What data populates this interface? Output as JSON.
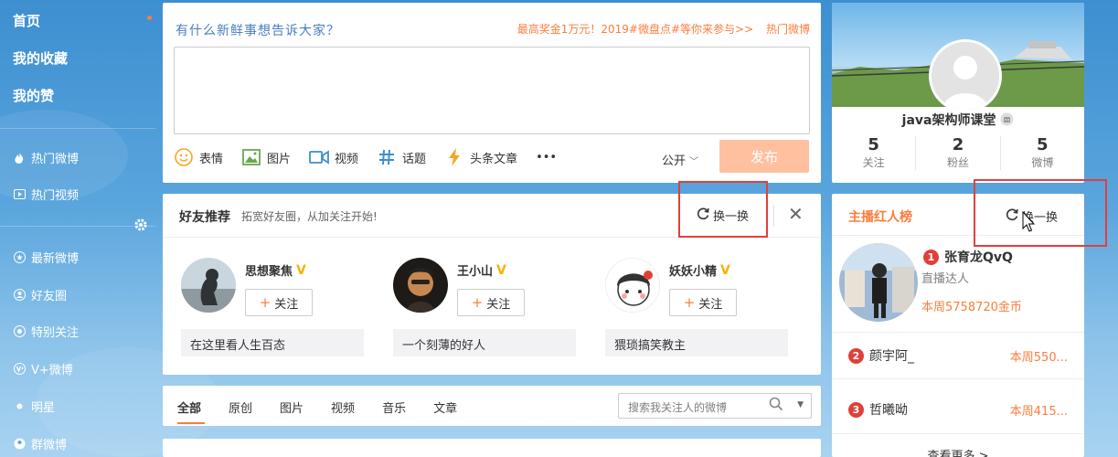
{
  "sidebar": {
    "items": [
      {
        "label": "首页",
        "icon": "home"
      },
      {
        "label": "我的收藏",
        "icon": "favorites"
      },
      {
        "label": "我的赞",
        "icon": "likes"
      },
      {
        "label": "热门微博",
        "icon": "fire-icon"
      },
      {
        "label": "热门视频",
        "icon": "video-icon"
      },
      {
        "label": "最新微博",
        "icon": "star-icon"
      },
      {
        "label": "好友圈",
        "icon": "friends-icon"
      },
      {
        "label": "特别关注",
        "icon": "target-icon"
      },
      {
        "label": "V+微博",
        "icon": "v-plus-icon"
      },
      {
        "label": "明星",
        "icon": "dot-icon"
      },
      {
        "label": "群微博",
        "icon": "group-icon"
      }
    ]
  },
  "composer": {
    "hint": "有什么新鲜事想告诉大家？",
    "promo": "最高奖金1万元！2019#微盘点#等你来参与>>",
    "hot_link": "热门微博",
    "tools": [
      {
        "label": "表情",
        "icon": "emoji-icon"
      },
      {
        "label": "图片",
        "icon": "image-icon"
      },
      {
        "label": "视频",
        "icon": "video-camera-icon"
      },
      {
        "label": "话题",
        "icon": "hashtag-icon"
      },
      {
        "label": "头条文章",
        "icon": "lightning-icon"
      },
      {
        "label": "•••",
        "icon": "more-icon"
      }
    ],
    "visibility": "公开",
    "publish": "发布"
  },
  "friends": {
    "title": "好友推荐",
    "subtitle": "拓宽好友圈，从加关注开始!",
    "refresh": "换一换",
    "follow_label": "关注",
    "list": [
      {
        "name": "思想聚焦",
        "desc": "在这里看人生百态"
      },
      {
        "name": "王小山",
        "desc": "一个刻薄的好人"
      },
      {
        "name": "妖妖小精",
        "desc": "猥琐搞笑教主"
      }
    ]
  },
  "feed": {
    "tabs": [
      "全部",
      "原创",
      "图片",
      "视频",
      "音乐",
      "文章"
    ],
    "search_placeholder": "搜索我关注人的微博"
  },
  "profile": {
    "name": "java架构师课堂",
    "stats": [
      {
        "num": "5",
        "label": "关注"
      },
      {
        "num": "2",
        "label": "粉丝"
      },
      {
        "num": "5",
        "label": "微博"
      }
    ]
  },
  "rank": {
    "title": "主播红人榜",
    "refresh": "换一换",
    "first": {
      "rank": "1",
      "name": "张育龙QvQ",
      "role": "直播达人",
      "coins": "本周5758720金币"
    },
    "others": [
      {
        "rank": "2",
        "name": "颜宇阿_",
        "value": "本周550..."
      },
      {
        "rank": "3",
        "name": "哲曦呦",
        "value": "本周415..."
      }
    ],
    "more": "查看更多 >"
  },
  "colors": {
    "accent": "#fa7d3c",
    "highlight": "#e0403a",
    "link": "#4a7ebc"
  }
}
